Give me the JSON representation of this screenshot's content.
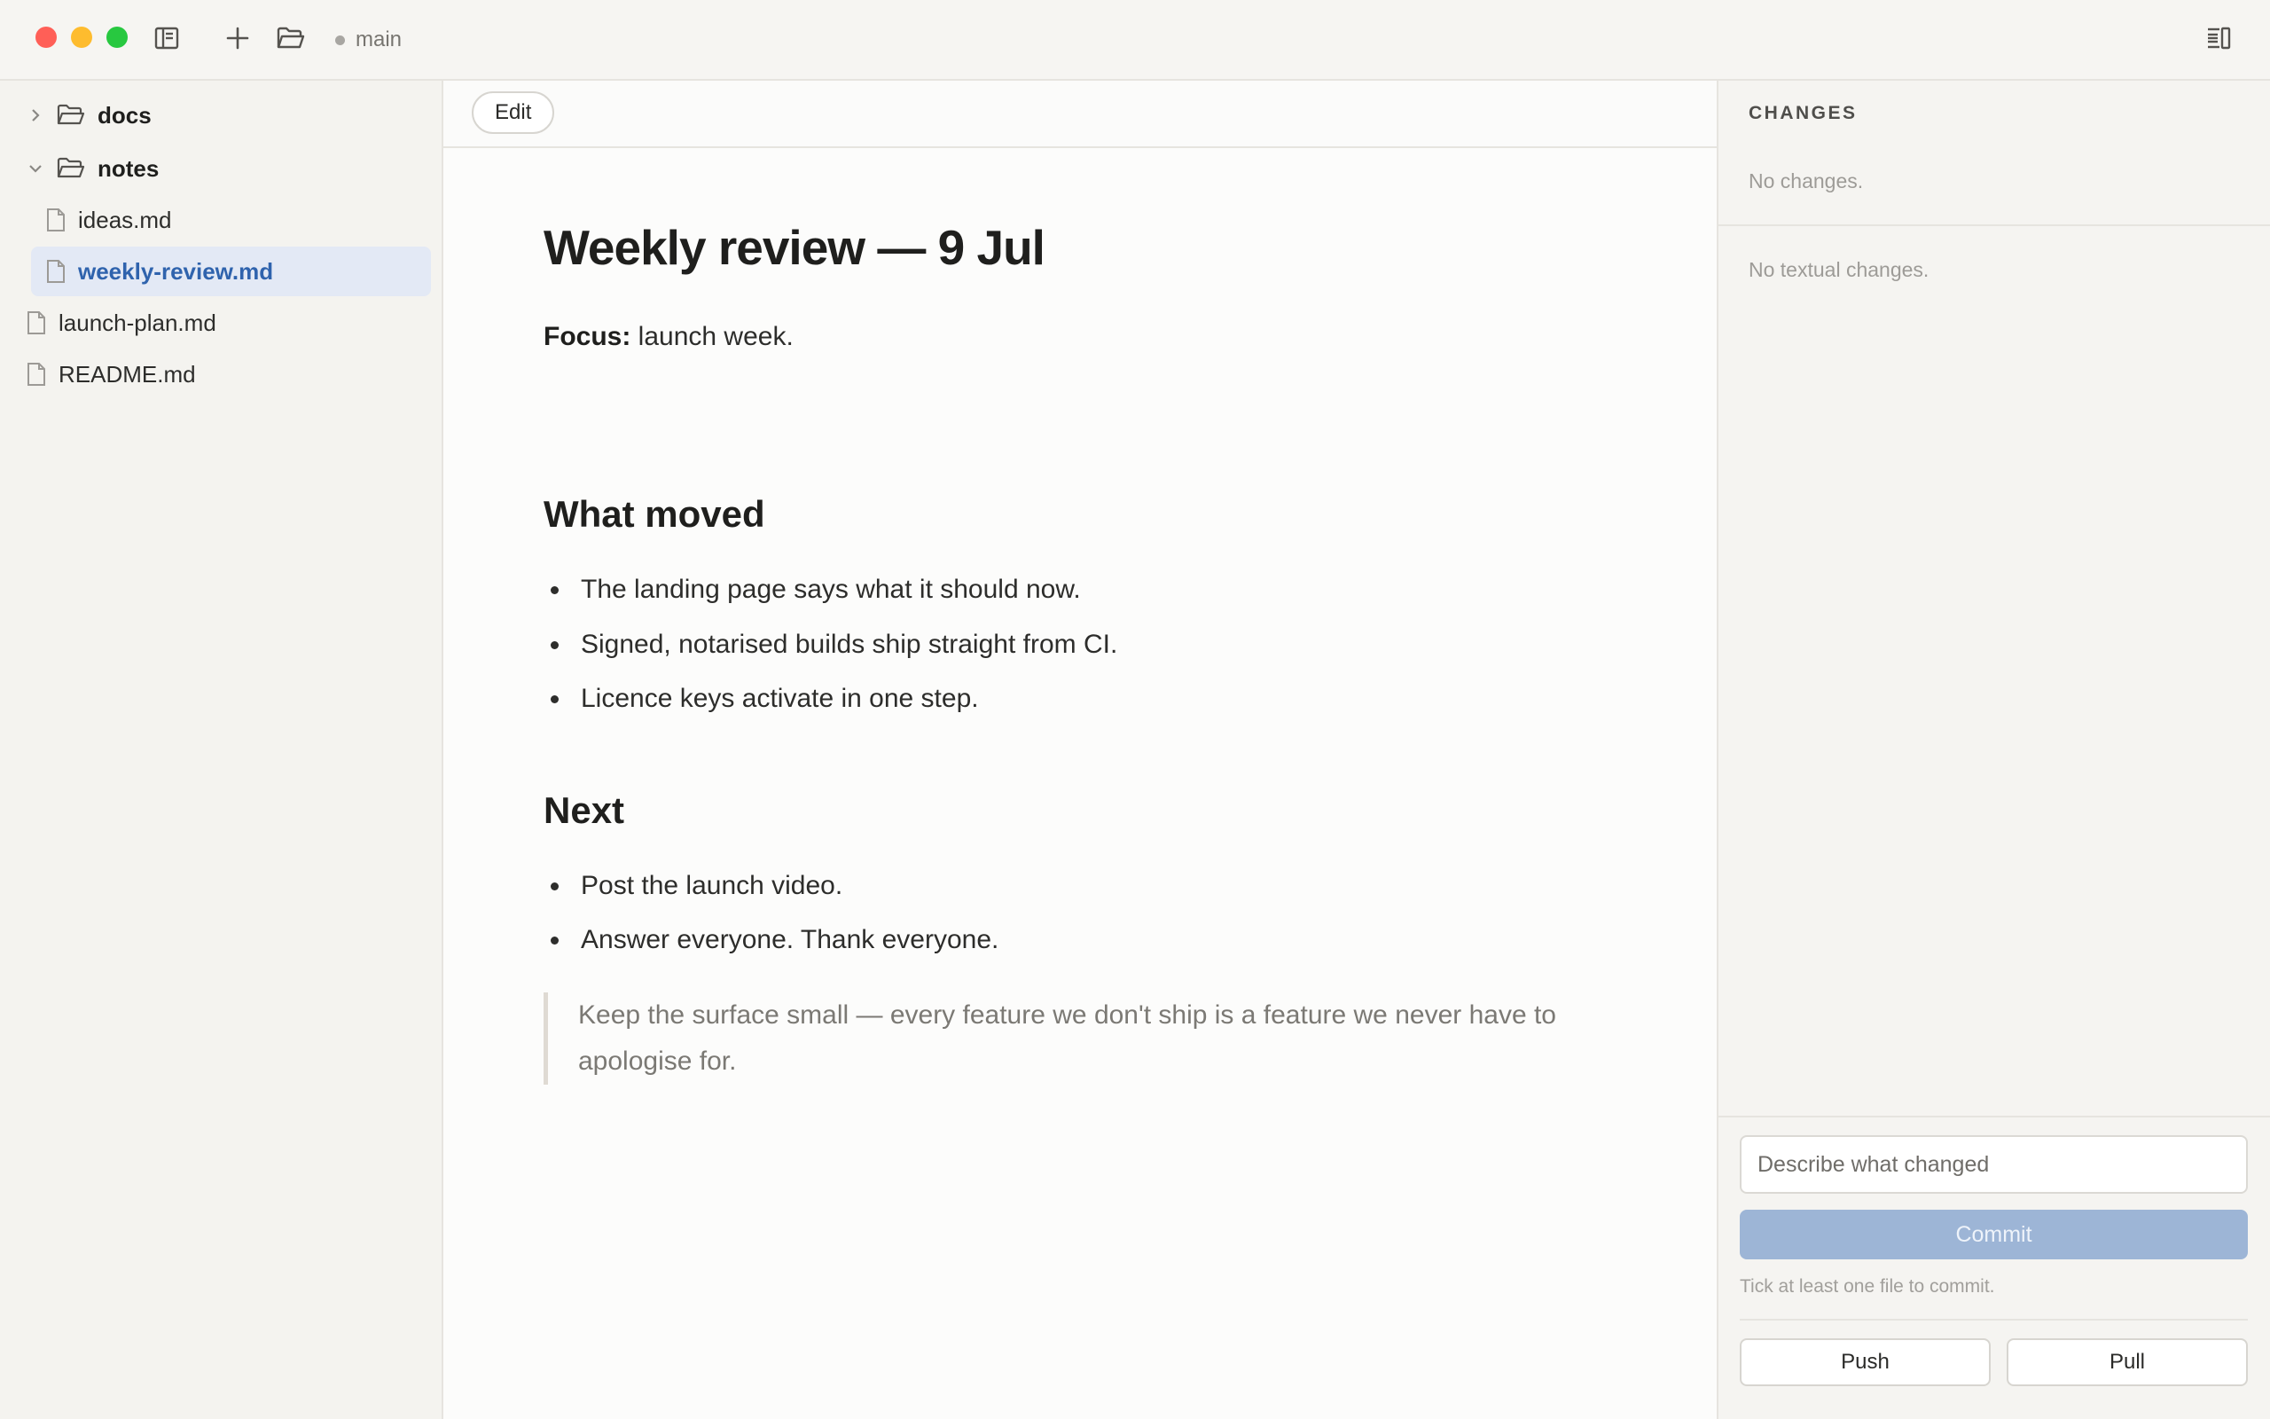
{
  "window": {
    "branch": "main",
    "colors": {
      "close": "#ff5f57",
      "minimize": "#febc2e",
      "zoom": "#28c840"
    },
    "icons": [
      "sidebar-toggle-icon",
      "plus-icon",
      "folder-open-icon",
      "right-panel-toggle-icon"
    ]
  },
  "sidebar": {
    "folders": [
      {
        "name": "docs",
        "expanded": false
      },
      {
        "name": "notes",
        "expanded": true
      }
    ],
    "notes_files": [
      "ideas.md",
      "weekly-review.md"
    ],
    "root_files": [
      "launch-plan.md",
      "README.md"
    ],
    "selected": "weekly-review.md",
    "selected_color": "#2f63ad"
  },
  "editor": {
    "edit_label": "Edit",
    "title": "Weekly review — 9 Jul",
    "focus_label": "Focus:",
    "focus_text": " launch week.",
    "sections": [
      {
        "heading": "What moved",
        "items": [
          "The landing page says what it should now.",
          "Signed, notarised builds ship straight from CI.",
          "Licence keys activate in one step."
        ]
      },
      {
        "heading": "Next",
        "items": [
          "Post the launch video.",
          "Answer everyone. Thank everyone."
        ]
      }
    ],
    "quote_line1": "Keep the surface small — every feature we don't ship is a feature we never have to",
    "quote_line2": "apologise for."
  },
  "changes": {
    "title": "CHANGES",
    "no_changes": "No changes.",
    "no_textual": "No textual changes.",
    "commit_placeholder": "Describe what changed",
    "commit_label": "Commit",
    "commit_hint": "Tick at least one file to commit.",
    "push_label": "Push",
    "pull_label": "Pull",
    "commit_color": "#9db5d6"
  }
}
